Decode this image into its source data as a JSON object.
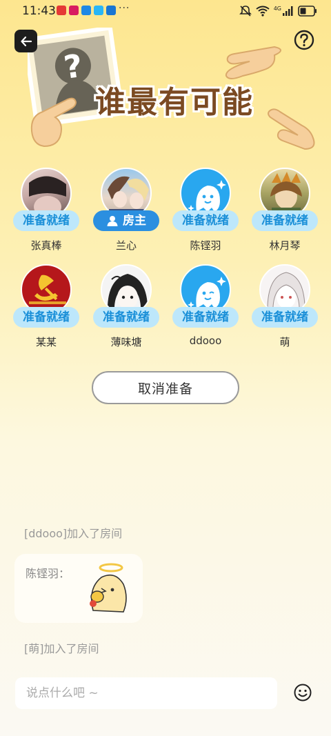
{
  "status": {
    "time": "11:43",
    "dots": "···",
    "network": "4G"
  },
  "banner": {
    "title": "谁最有可能"
  },
  "players": [
    {
      "name": "张真棒",
      "badge": "准备就绪",
      "role": "ready"
    },
    {
      "name": "兰心",
      "badge": "房主",
      "role": "owner"
    },
    {
      "name": "陈铿羽",
      "badge": "准备就绪",
      "role": "ready"
    },
    {
      "name": "林月琴",
      "badge": "准备就绪",
      "role": "ready"
    },
    {
      "name": "某某",
      "badge": "准备就绪",
      "role": "ready"
    },
    {
      "name": "薄味塘",
      "badge": "准备就绪",
      "role": "ready"
    },
    {
      "name": "ddooo",
      "badge": "准备就绪",
      "role": "ready"
    },
    {
      "name": "萌",
      "badge": "准备就绪",
      "role": "ready"
    }
  ],
  "actions": {
    "cancel_ready": "取消准备"
  },
  "chat": {
    "messages": [
      {
        "type": "system",
        "text": "[ddooo]加入了房间"
      },
      {
        "type": "sticker",
        "sender": "陈铿羽："
      },
      {
        "type": "system",
        "text": "[萌]加入了房间"
      }
    ],
    "input_placeholder": "说点什么吧 ~"
  },
  "colors": {
    "badge_bg": "#bde7fb",
    "badge_text": "#1a8fd8",
    "owner_bg": "#2b8fe0",
    "title": "#7b4a22"
  }
}
